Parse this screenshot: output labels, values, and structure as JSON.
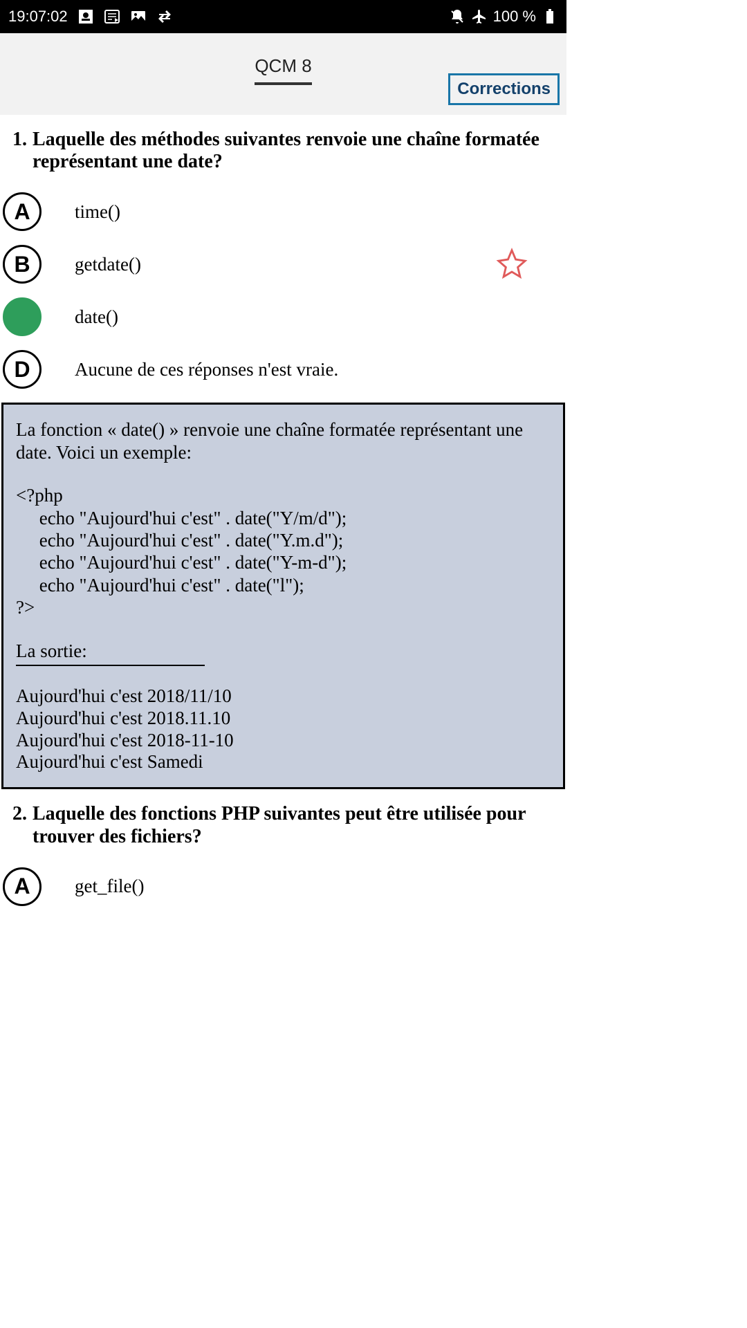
{
  "status": {
    "time": "19:07:02",
    "battery": "100 %"
  },
  "header": {
    "tab": "QCM 8",
    "corrections": "Corrections"
  },
  "q1": {
    "num": "1.",
    "text": "Laquelle des méthodes suivantes renvoie une chaîne formatée représentant une date?",
    "optA": "time()",
    "optB": "getdate()",
    "optC": "date()",
    "optD": "Aucune de ces réponses n'est vraie.",
    "letterA": "A",
    "letterB": "B",
    "letterD": "D"
  },
  "exp": {
    "intro": "La fonction « date() » renvoie une chaîne formatée représentant une date. Voici un exemple:",
    "code": "<?php\n     echo \"Aujourd'hui c'est\" . date(\"Y/m/d\");\n     echo \"Aujourd'hui c'est\" . date(\"Y.m.d\");\n     echo \"Aujourd'hui c'est\" . date(\"Y-m-d\");\n     echo \"Aujourd'hui c'est\" . date(\"l\");\n?>",
    "outlabel": "La sortie:",
    "output": "Aujourd'hui c'est 2018/11/10\nAujourd'hui c'est 2018.11.10\nAujourd'hui c'est 2018-11-10\nAujourd'hui c'est Samedi"
  },
  "q2": {
    "num": "2.",
    "text": "Laquelle des fonctions PHP suivantes peut être utilisée pour trouver des fichiers?",
    "optA": "get_file()",
    "letterA": "A"
  }
}
